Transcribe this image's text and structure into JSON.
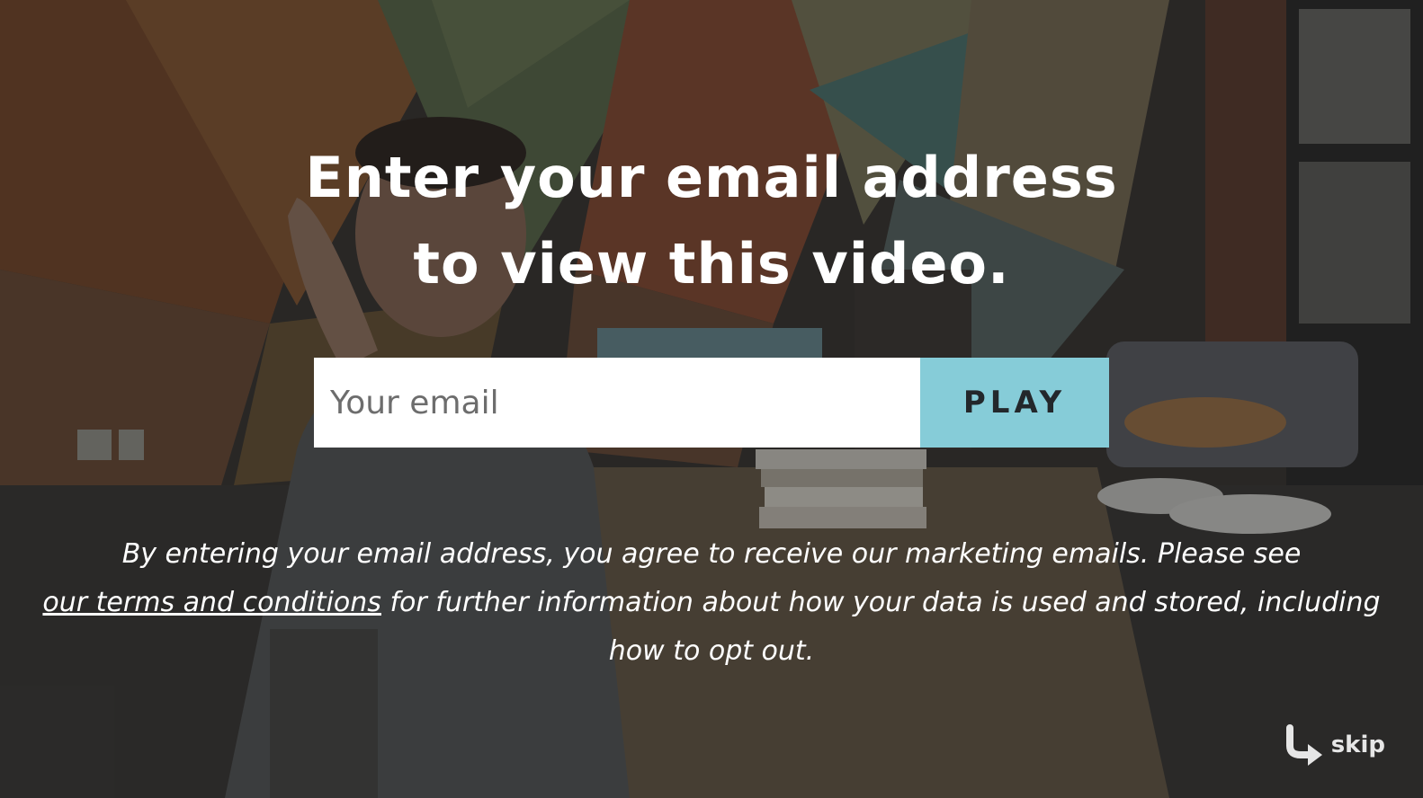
{
  "gate": {
    "headline_line1": "Enter your email address",
    "headline_line2": "to view this video.",
    "email_placeholder": "Your email",
    "email_value": "",
    "play_label": "PLAY",
    "disclaimer_before": "By entering your email address, you agree to receive our marketing emails. Please see",
    "terms_link": "our terms and conditions",
    "disclaimer_after": "for further information about how your data is used and stored, including how to opt out.",
    "skip_label": "skip",
    "skip_icon": "curved-arrow-icon"
  },
  "colors": {
    "play_button": "#86ccd8",
    "overlay": "#121212",
    "text": "#ffffff"
  }
}
